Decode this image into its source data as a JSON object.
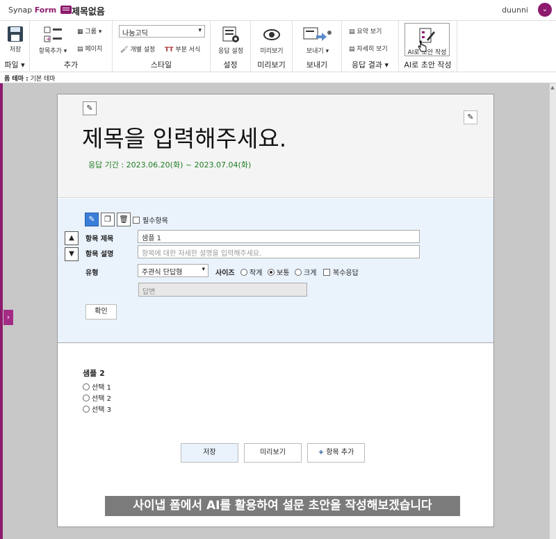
{
  "app": {
    "logo_text": "Synap",
    "logo_bold": "Form",
    "doc_title": "제목없음",
    "user": "duunni"
  },
  "ribbon": {
    "file": {
      "save": "저장",
      "label": "파일"
    },
    "add": {
      "add_item": "항목추가",
      "group": "그룹",
      "page": "페이지",
      "label": "추가"
    },
    "style": {
      "font": "나눔고딕",
      "individual": "개별 설정",
      "partial": "부분 서식",
      "label": "스타일"
    },
    "settings": {
      "response_settings": "응답 설정",
      "label": "설정"
    },
    "preview": {
      "preview": "미리보기",
      "label": "미리보기"
    },
    "send": {
      "send": "보내기",
      "label": "보내기"
    },
    "results": {
      "summary": "요약 보기",
      "detail": "자세히 보기",
      "label": "응답 결과"
    },
    "ai": {
      "button": "AI로 초안 작성",
      "label": "AI로 초안 작성"
    }
  },
  "theme_bar": {
    "label": "폼 테마 :",
    "value": "기본 테마"
  },
  "form": {
    "title": "제목을 입력해주세요.",
    "period": "응답 기간 : 2023.06.20(화) ~ 2023.07.04(화)"
  },
  "editor": {
    "required": "필수항목",
    "item_title_label": "항목 제목",
    "item_title_value": "샘플 1",
    "item_desc_label": "항목 설명",
    "item_desc_placeholder": "항목에 대한 자세한 설명을 입력해주세요.",
    "type_label": "유형",
    "type_value": "주관식 단답형",
    "size_label": "사이즈",
    "size_options": [
      "작게",
      "보통",
      "크게"
    ],
    "size_selected": "보통",
    "multi_answer": "복수응답",
    "answer_placeholder": "답변",
    "confirm": "확인"
  },
  "question2": {
    "title": "샘플 2",
    "choices": [
      "선택 1",
      "선택 2",
      "선택 3"
    ]
  },
  "footer_buttons": {
    "save": "저장",
    "preview": "미리보기",
    "add_item": "항목 추가"
  },
  "caption": "사이냅 폼에서 AI를 활용하여 설문 초안을 작성해보겠습니다"
}
